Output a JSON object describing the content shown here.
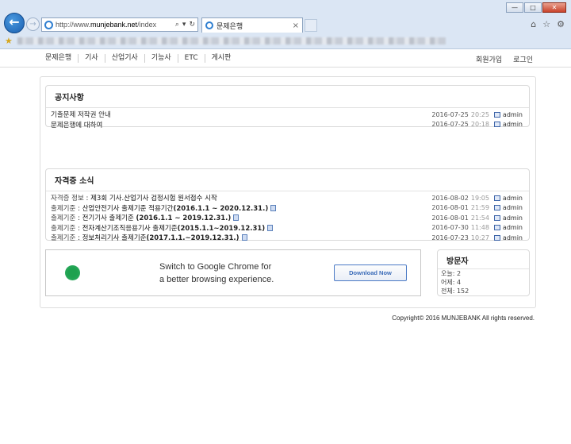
{
  "browser": {
    "url_prefix": "http://www.",
    "url_domain": "munjebank.net",
    "url_path": "/index",
    "search_icon": "⌕",
    "dropdown_icon": "▾",
    "refresh_icon": "↻",
    "tab_title": "문제은행",
    "tab_close": "×",
    "window_buttons": [
      "—",
      "□",
      "✕"
    ],
    "right_icons": [
      "⌂",
      "☆",
      "⚙"
    ]
  },
  "nav": {
    "left_items": [
      "문제은행",
      "기사",
      "산업기사",
      "기능사",
      "ETC",
      "게시판"
    ],
    "right_items": [
      "회원가입",
      "로그인"
    ]
  },
  "notices": {
    "title": "공지사항",
    "rows": [
      {
        "subject": "기출문제 저작권 안내",
        "date": "2016-07-25",
        "time": "20:25",
        "user": "admin"
      },
      {
        "subject": "문제은행에 대하여",
        "date": "2016-07-25",
        "time": "20:18",
        "user": "admin"
      }
    ]
  },
  "news": {
    "title": "자격증 소식",
    "rows": [
      {
        "category": "자격증 정보",
        "subject": "제3회 기사.산업기사 검정시험 원서접수 시작",
        "date": "2016-08-02",
        "time": "19:05",
        "user": "admin"
      },
      {
        "category": "출제기준",
        "subject": "산업안전기사 출제기준 적용기간",
        "bold": "(2016.1.1 ~ 2020.12.31.)",
        "date": "2016-08-01",
        "time": "21:59",
        "user": "admin"
      },
      {
        "category": "출제기준",
        "subject": "전기기사 출제기준",
        "bold": "(2016.1.1 ~ 2019.12.31.)",
        "date": "2016-08-01",
        "time": "21:54",
        "user": "admin"
      },
      {
        "category": "출제기준",
        "subject": "전자계산기조직응용기사 출제기준",
        "bold": "(2015.1.1~2019.12.31)",
        "date": "2016-07-30",
        "time": "11:48",
        "user": "admin"
      },
      {
        "category": "출제기준",
        "subject": "정보처리기사 출제기준",
        "bold": "(2017.1.1.~2019.12.31.)",
        "date": "2016-07-23",
        "time": "10:27",
        "user": "admin"
      }
    ]
  },
  "ad": {
    "line1": "Switch to Google Chrome for",
    "line2": "a better browsing experience.",
    "button": "Download Now"
  },
  "visitors": {
    "title": "방문자",
    "today": "오늘: 2",
    "yesterday": "어제: 4",
    "total": "전체: 152"
  },
  "footer": {
    "copyright": "Copyright© 2016 MUNJEBANK All rights reserved."
  }
}
